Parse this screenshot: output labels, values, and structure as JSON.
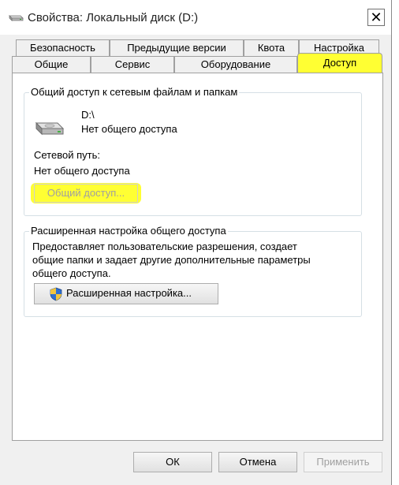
{
  "window": {
    "title": "Свойства: Локальный диск (D:)",
    "close_glyph": "✕"
  },
  "tabs_top": [
    {
      "label": "Безопасность"
    },
    {
      "label": "Предыдущие версии"
    },
    {
      "label": "Квота"
    },
    {
      "label": "Настройка"
    }
  ],
  "tabs_bottom": [
    {
      "label": "Общие"
    },
    {
      "label": "Сервис"
    },
    {
      "label": "Оборудование"
    },
    {
      "label": "Доступ",
      "active": true
    }
  ],
  "share_group": {
    "title": "Общий доступ к сетевым файлам и папкам",
    "drive_name": "D:\\",
    "drive_status": "Нет общего доступа",
    "network_path_label": "Сетевой путь:",
    "network_path_value": "Нет общего доступа",
    "share_button": "Общий доступ..."
  },
  "advanced_group": {
    "title": "Расширенная настройка общего доступа",
    "description_lines": [
      "Предоставляет пользовательские разрешения, создает",
      "общие папки и задает другие дополнительные параметры",
      "общего доступа."
    ],
    "advanced_button": "Расширенная настройка..."
  },
  "footer": {
    "ok": "ОК",
    "cancel": "Отмена",
    "apply": "Применить"
  },
  "colors": {
    "highlight": "#ffff33",
    "window_bg": "#f0f0f0"
  }
}
